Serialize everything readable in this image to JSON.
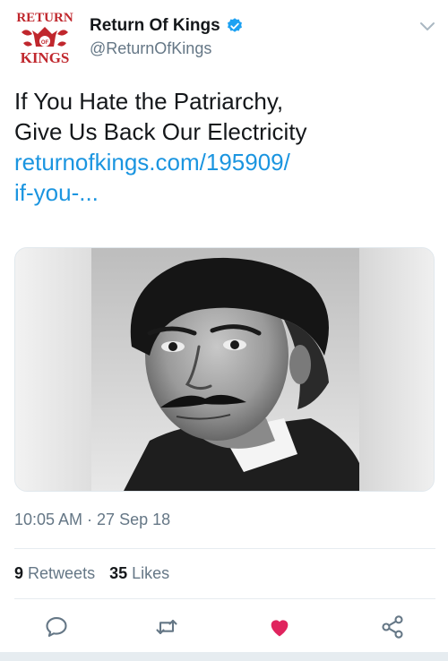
{
  "account": {
    "display_name": "Return Of Kings",
    "handle": "@ReturnOfKings",
    "avatar_logo_text": [
      "RETURN",
      "OF",
      "KINGS"
    ],
    "verified": true
  },
  "tweet": {
    "text_line1": "If You Hate the Patriarchy,",
    "text_line2": "Give Us Back Our Electricity",
    "link_line1": "returnofkings.com/195909/",
    "link_line2": "if-you-...",
    "media": "portrait-photo"
  },
  "timestamp": "10:05 AM · 27 Sep 18",
  "stats": {
    "retweets_count": "9",
    "retweets_label": "Retweets",
    "likes_count": "35",
    "likes_label": "Likes"
  },
  "actions": {
    "reply_icon": "reply-icon",
    "retweet_icon": "retweet-icon",
    "like_icon": "heart-icon",
    "share_icon": "share-icon"
  },
  "colors": {
    "link": "#1b95e0",
    "secondary_text": "#657786",
    "verified": "#1da1f2",
    "like": "#e0245e",
    "logo": "#c0272d"
  }
}
